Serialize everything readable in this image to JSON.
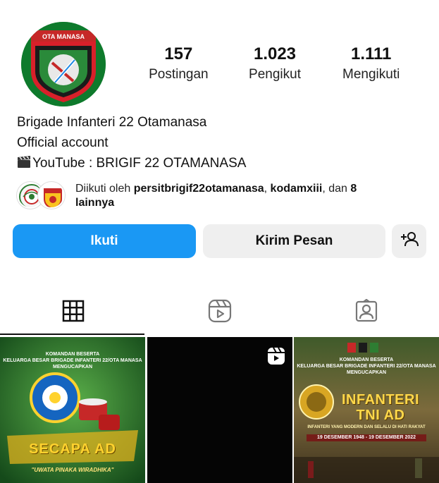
{
  "profile": {
    "avatar_text": "OTA MANASA",
    "name": "Brigade Infanteri 22 Otamanasa",
    "category": "Official account",
    "bio_link": "YouTube : BRIGIF 22 OTAMANASA"
  },
  "stats": [
    {
      "value": "157",
      "label": "Postingan"
    },
    {
      "value": "1.023",
      "label": "Pengikut"
    },
    {
      "value": "1.111",
      "label": "Mengikuti"
    }
  ],
  "followed_by": {
    "prefix": "Diikuti oleh ",
    "user1": "persitbrigif22otamanasa",
    "separator": ", ",
    "user2": "kodamxiii",
    "middle": ", dan ",
    "count": "8",
    "suffix_bold": "lainnya"
  },
  "actions": {
    "follow_label": "Ikuti",
    "message_label": "Kirim Pesan",
    "add_friend_icon": "person-add-icon"
  },
  "tabs": [
    {
      "icon": "grid-icon",
      "active": true
    },
    {
      "icon": "reels-icon",
      "active": false
    },
    {
      "icon": "tagged-icon",
      "active": false
    }
  ],
  "posts": [
    {
      "type": "image",
      "heading": "KOMANDAN BESERTA\nKELUARGA BESAR BRIGADE INFANTERI 22/OTA MANASA\nMENGUCAPKAN",
      "title": "SECAPA AD",
      "motto": "\"UWATA PINAKA WIRADHIKA\""
    },
    {
      "type": "reel",
      "badge_icon": "reels-badge-icon"
    },
    {
      "type": "image",
      "heading": "KOMANDAN BESERTA\nKELUARGA BESAR BRIGADE INFANTERI 22/OTA MANASA\nMENGUCAPKAN",
      "title": "INFANTERI\nTNI AD",
      "subtitle": "INFANTERI YANG MODERN DAN SELALU DI HATI RAKYAT",
      "dates": "19 DESEMBER 1948 - 19 DESEMBER 2022"
    }
  ],
  "colors": {
    "primary_button": "#1a98f4",
    "secondary_button": "#efefef",
    "text": "#111111"
  }
}
